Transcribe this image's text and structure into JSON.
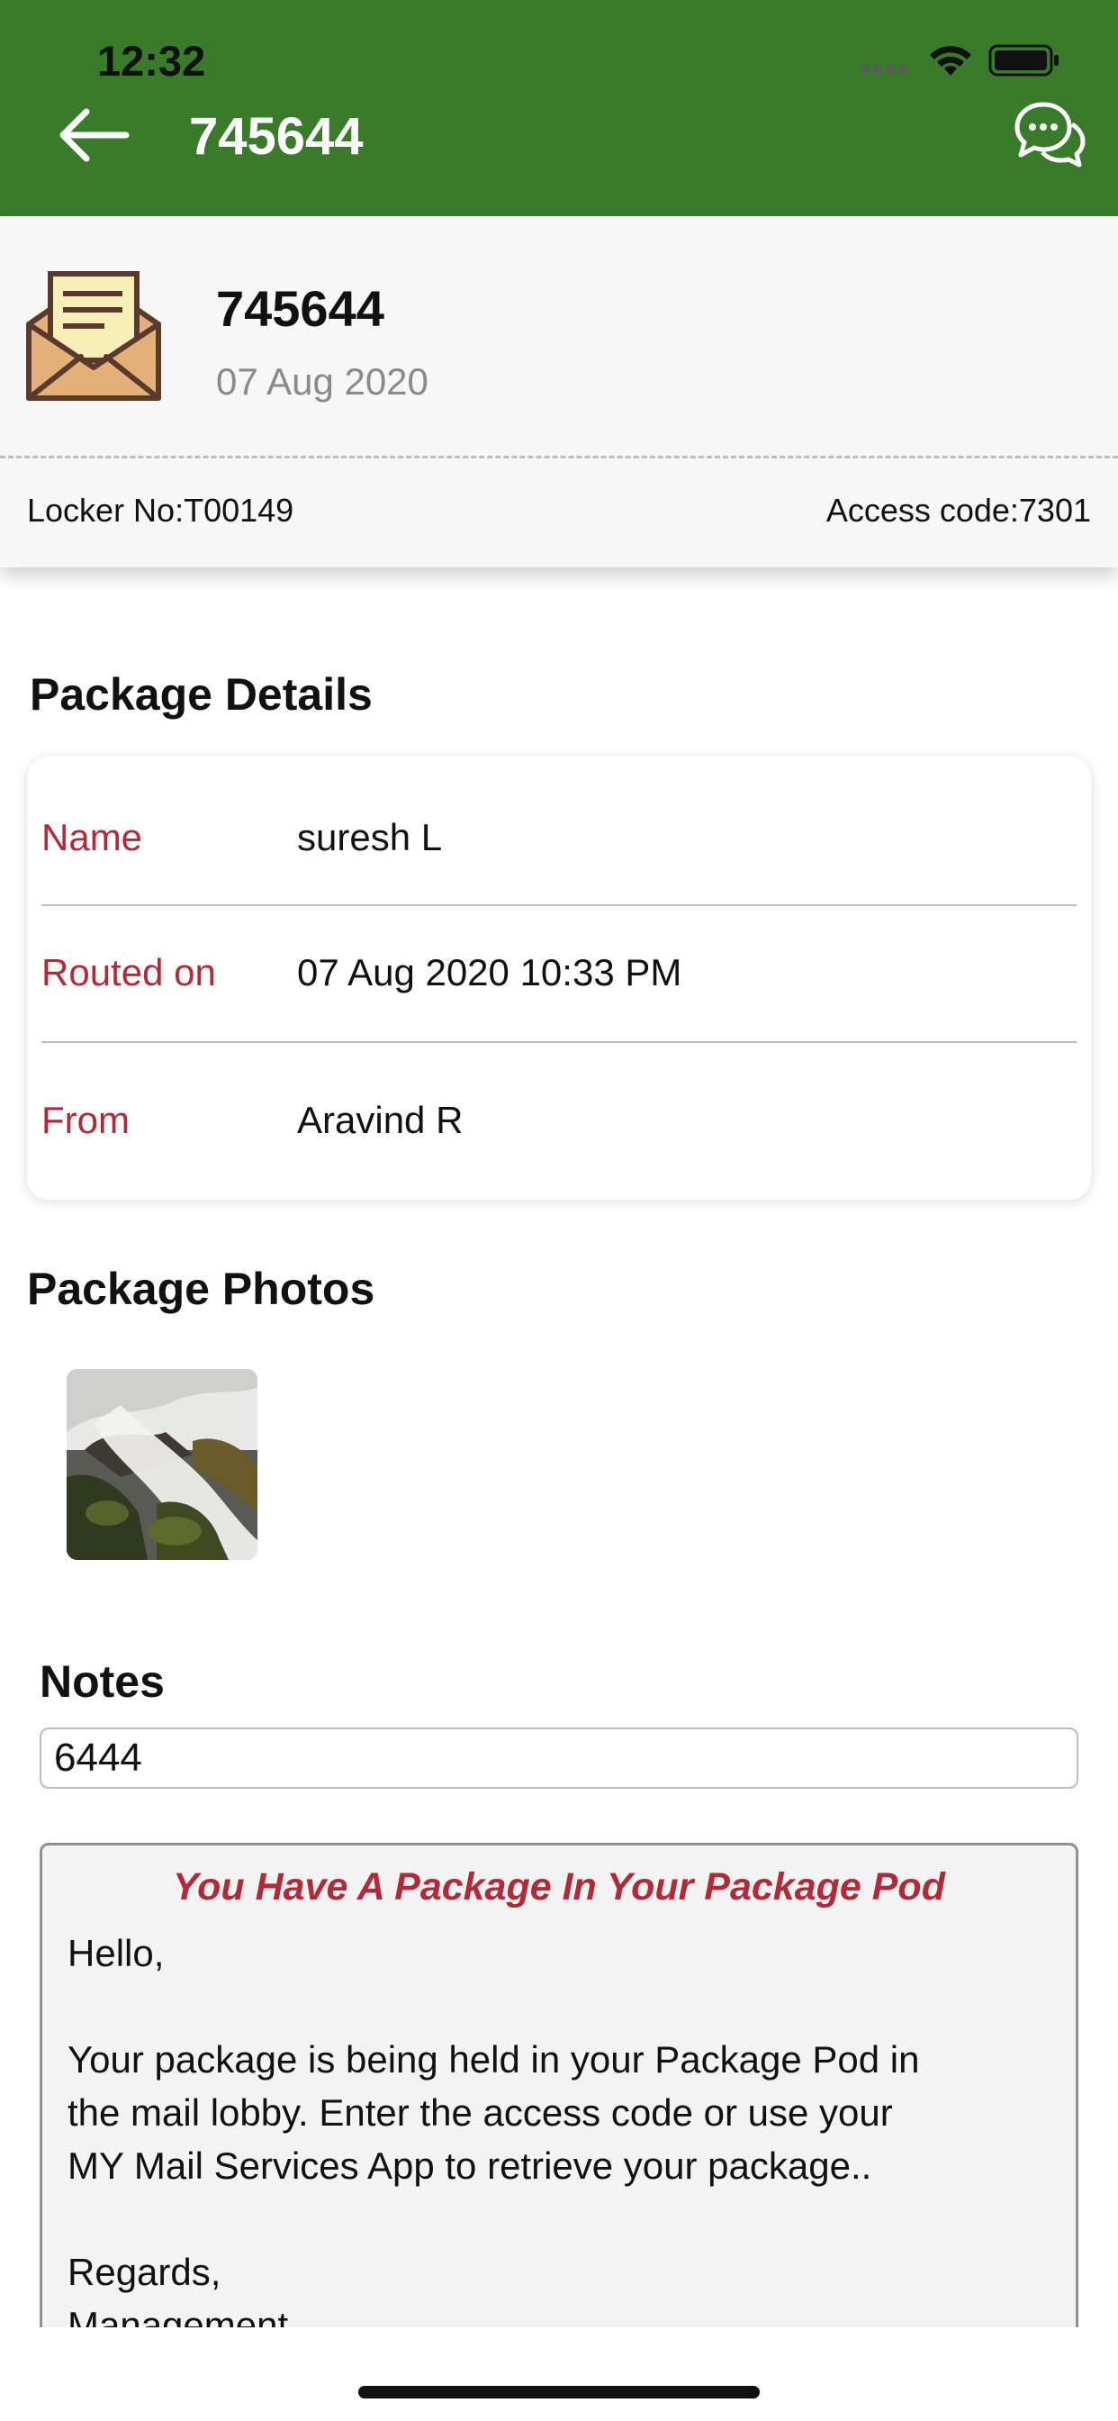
{
  "status_bar": {
    "time": "12:32"
  },
  "header": {
    "title": "745644",
    "back_icon": "arrow-left-icon",
    "chat_icon": "chat-bubbles-icon",
    "background": "#3a7a2b"
  },
  "summary": {
    "package_id": "745644",
    "date": "07 Aug 2020",
    "locker": "Locker No:T00149",
    "access_code": "Access code:7301",
    "icon": "envelope-open-icon"
  },
  "package_details": {
    "title": "Package Details",
    "rows": [
      {
        "label": "Name",
        "value": "suresh L"
      },
      {
        "label": "Routed on",
        "value": "07 Aug 2020 10:33 PM"
      },
      {
        "label": "From",
        "value": "Aravind R"
      }
    ]
  },
  "package_photos": {
    "title": "Package Photos"
  },
  "notes": {
    "title": "Notes",
    "value": "6444"
  },
  "message": {
    "title": "You Have A Package In Your Package Pod",
    "greeting": "Hello,",
    "body_line1": "Your package is being held in your Package Pod in",
    "body_line2": "the mail lobby. Enter the access code or use your",
    "body_line3": "MY Mail Services App to retrieve your package..",
    "sign_off": "Regards,",
    "signature": "Management"
  },
  "colors": {
    "accent_red": "#b12a3a",
    "header_green": "#3a7a2b"
  }
}
